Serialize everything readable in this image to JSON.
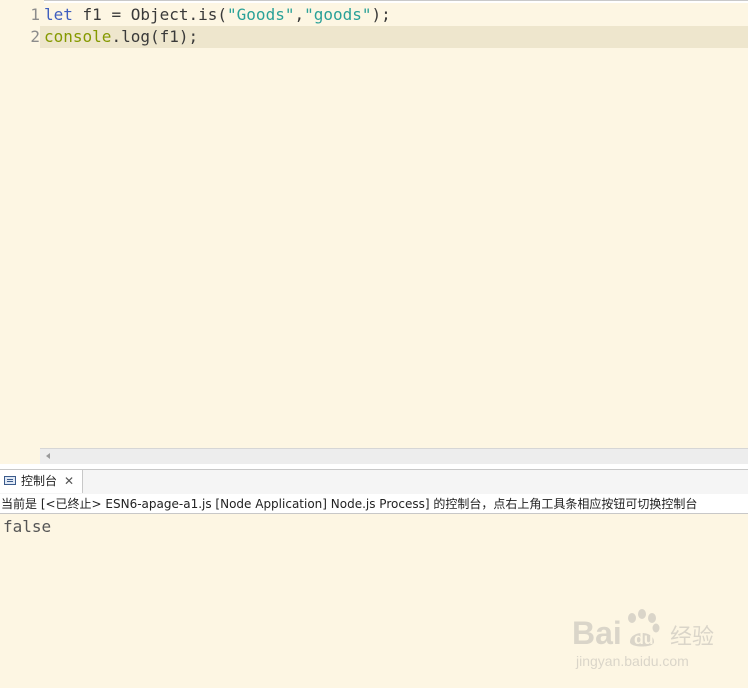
{
  "editor": {
    "lines": [
      {
        "number": "1",
        "tokens": {
          "kw": "let",
          "p1": " f1 = Object.is(",
          "s1": "\"Goods\"",
          "p2": ",",
          "s2": "\"goods\"",
          "p3": ");"
        }
      },
      {
        "number": "2",
        "tokens": {
          "fn": "console",
          "p1": ".log(f1);"
        }
      }
    ]
  },
  "console": {
    "tab_label": "控制台",
    "close_glyph": "✕",
    "status": "当前是 [<已终止> ESN6-apage-a1.js [Node Application] Node.js Process] 的控制台，点右上角工具条相应按钮可切换控制台",
    "output": "false"
  },
  "watermark": {
    "brand": "Bai",
    "suffix": "du",
    "cn": "经验",
    "url": "jingyan.baidu.com"
  },
  "colors": {
    "background": "#fdf6e3",
    "current_line": "#eee6cd",
    "keyword": "#3f5fbf",
    "string": "#2aa198",
    "function": "#859900"
  }
}
